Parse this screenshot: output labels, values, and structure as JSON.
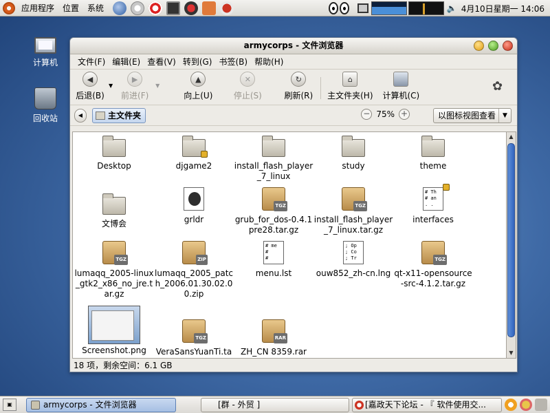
{
  "top_panel": {
    "menus": [
      "应用程序",
      "位置",
      "系统"
    ],
    "clock": "4月10日星期一 14:06",
    "volume_icon": "speaker-icon"
  },
  "desktop": {
    "icons": [
      {
        "label": "计算机",
        "icon": "computer-icon"
      },
      {
        "label": "回收站",
        "icon": "trash-icon"
      }
    ]
  },
  "window": {
    "title": "armycorps - 文件浏览器",
    "menubar": [
      "文件(F)",
      "编辑(E)",
      "查看(V)",
      "转到(G)",
      "书签(B)",
      "帮助(H)"
    ],
    "toolbar": {
      "back": "后退(B)",
      "forward": "前进(F)",
      "up": "向上(U)",
      "stop": "停止(S)",
      "reload": "刷新(R)",
      "home": "主文件夹(H)",
      "computer": "计算机(C)"
    },
    "location": {
      "crumb": "主文件夹",
      "zoom": "75%",
      "view_mode": "以图标视图查看"
    },
    "files": [
      {
        "name": "Desktop",
        "kind": "folder"
      },
      {
        "name": "djgame2",
        "kind": "folder-locked"
      },
      {
        "name": "install_flash_player_7_linux",
        "kind": "folder"
      },
      {
        "name": "study",
        "kind": "folder"
      },
      {
        "name": "theme",
        "kind": "folder"
      },
      {
        "name": "文博会",
        "kind": "folder"
      },
      {
        "name": "grldr",
        "kind": "binary"
      },
      {
        "name": "grub_for_dos-0.4.1pre28.tar.gz",
        "kind": "tgz"
      },
      {
        "name": "install_flash_player_7_linux.tar.gz",
        "kind": "tgz"
      },
      {
        "name": "interfaces",
        "kind": "text-locked"
      },
      {
        "name": "lumaqq_2005-linux_gtk2_x86_no_jre.tar.gz",
        "kind": "tgz"
      },
      {
        "name": "lumaqq_2005_patch_2006.01.30.02.00.zip",
        "kind": "zip"
      },
      {
        "name": "menu.lst",
        "kind": "text"
      },
      {
        "name": "ouw852_zh-cn.lng",
        "kind": "text"
      },
      {
        "name": "qt-x11-opensource-src-4.1.2.tar.gz",
        "kind": "tgz"
      },
      {
        "name": "Screenshot.png",
        "kind": "image"
      },
      {
        "name": "VeraSansYuanTi.ta",
        "kind": "tgz"
      },
      {
        "name": "ZH_CN 8359.rar",
        "kind": "rar"
      }
    ],
    "icon_text": {
      "interfaces": [
        "# Th",
        "# an",
        ". ."
      ],
      "menu_lst": [
        "# me",
        "#",
        "#"
      ],
      "lng": [
        "; Op",
        "; Co",
        "; Tr"
      ],
      "tags": {
        "tgz": "TGZ",
        "zip": "ZIP",
        "rar": "RAR"
      }
    },
    "status": "18 项，剩余空间：6.1 GB"
  },
  "bottom_panel": {
    "tasks": [
      {
        "label": "armycorps - 文件浏览器",
        "active": true
      },
      {
        "label": "[群 - 外贸 ]",
        "active": false
      },
      {
        "label": "[嘉政天下论坛 - 『 软件使用交...",
        "active": false
      }
    ]
  },
  "colors": {
    "desktop_bg": "#3f6aa6",
    "selection_blue": "#3164bf",
    "panel_bg": "#e6e4df"
  }
}
